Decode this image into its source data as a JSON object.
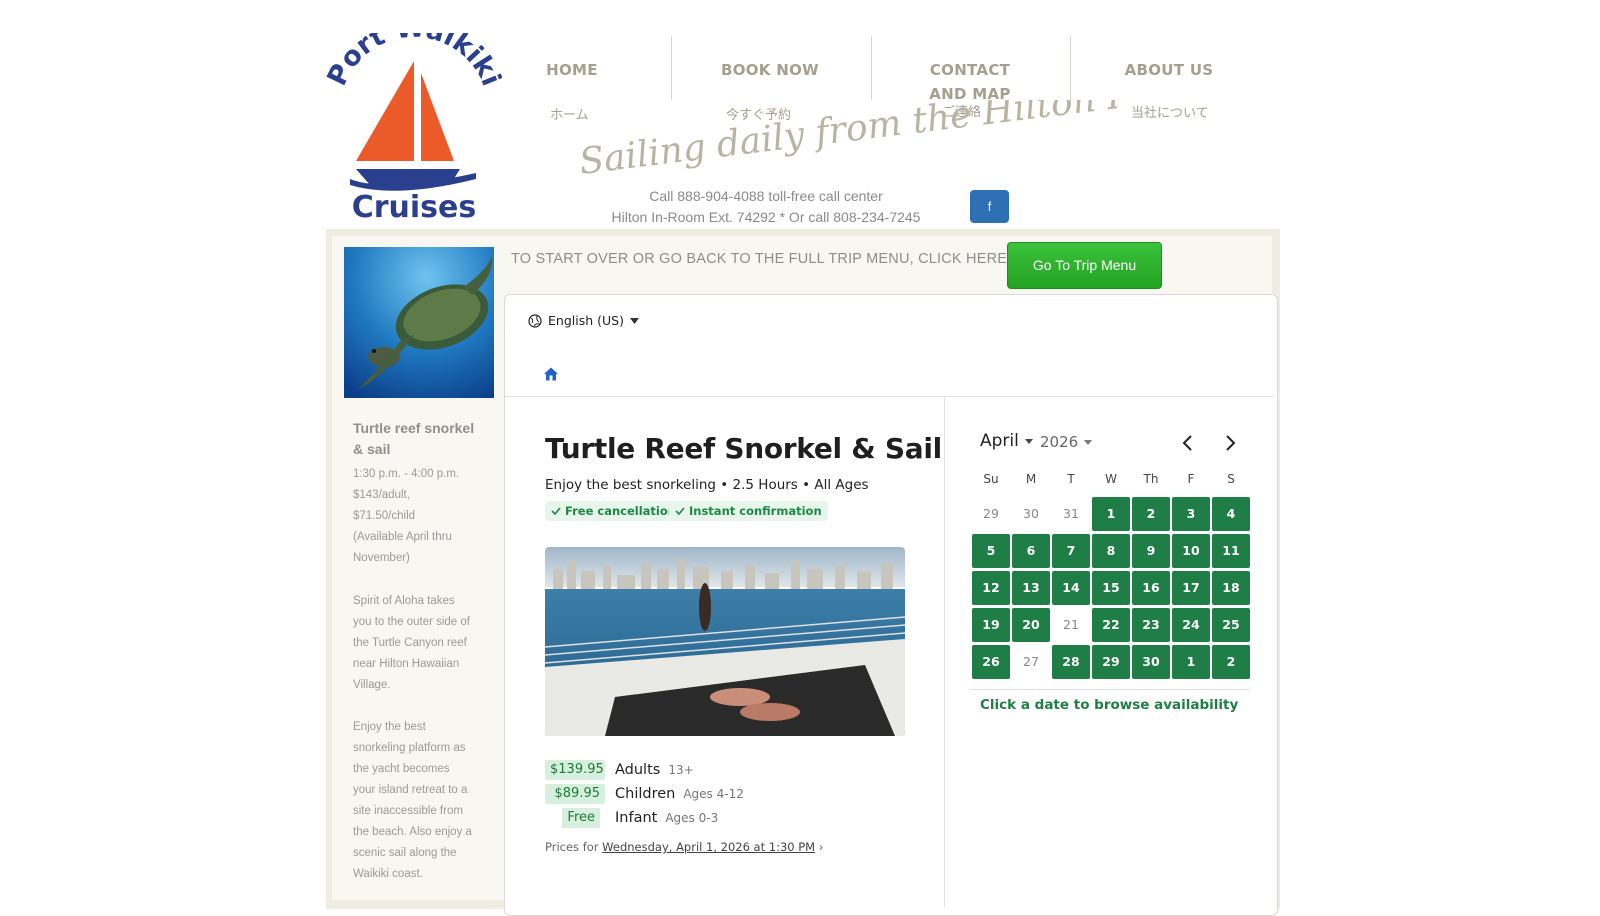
{
  "header": {
    "logo": {
      "line1": "Port Waikiki",
      "line2": "Cruises"
    },
    "nav": [
      {
        "en": "HOME",
        "jp": "ホーム"
      },
      {
        "en": "BOOK NOW",
        "jp": "今すぐ予約"
      },
      {
        "en": "CONTACT AND MAP",
        "jp": "ご連絡"
      },
      {
        "en": "ABOUT US",
        "jp": "当社について"
      }
    ],
    "tagline": "Sailing daily from the Hilton Pier",
    "phone1": "Call 888-904-4088 toll-free call center",
    "phone2": "Hilton In-Room Ext. 74292 * Or call 808-234-7245",
    "facebook_label": "f"
  },
  "trip_menu": {
    "text": "TO START OVER OR GO BACK TO THE FULL TRIP MENU, CLICK HERE:",
    "button": "Go To Trip Menu"
  },
  "sidebar": {
    "title": "Turtle reef snorkel & sail",
    "details": [
      "1:30 p.m. - 4:00 p.m.",
      "$143/adult,",
      "$71.50/child",
      "(Available April thru",
      "November)"
    ],
    "para1": [
      "Spirit of Aloha takes",
      "you to the outer side of",
      "the Turtle Canyon reef",
      "near Hilton Hawaiian",
      "Village."
    ],
    "para2": [
      "Enjoy the best",
      "snorkeling platform as",
      "the yacht becomes",
      "your island retreat to a",
      "site inaccessible from",
      "the beach. Also enjoy a",
      "scenic sail along the",
      "Waikiki coast."
    ]
  },
  "widget": {
    "language": "English (US)",
    "product_title": "Turtle Reef Snorkel & Sail",
    "product_subtitle": "Enjoy the best snorkeling • 2.5 Hours • All Ages",
    "badges": [
      "Free cancellation",
      "Instant confirmation"
    ],
    "prices": [
      {
        "price": "$139.95",
        "name": "Adults",
        "age": "13+"
      },
      {
        "price": "$89.95",
        "name": "Children",
        "age": "Ages 4-12"
      },
      {
        "price": "Free",
        "name": "Infant",
        "age": "Ages 0-3"
      }
    ],
    "prices_for_label": "Prices for",
    "prices_for_date": "Wednesday, April 1, 2026 at 1:30 PM",
    "prices_for_arrow": "›"
  },
  "calendar": {
    "month": "April",
    "year": "2026",
    "weekdays": [
      "Su",
      "M",
      "T",
      "W",
      "Th",
      "F",
      "S"
    ],
    "weeks": [
      [
        {
          "d": "29",
          "a": false
        },
        {
          "d": "30",
          "a": false
        },
        {
          "d": "31",
          "a": false
        },
        {
          "d": "1",
          "a": true
        },
        {
          "d": "2",
          "a": true
        },
        {
          "d": "3",
          "a": true
        },
        {
          "d": "4",
          "a": true
        }
      ],
      [
        {
          "d": "5",
          "a": true
        },
        {
          "d": "6",
          "a": true
        },
        {
          "d": "7",
          "a": true
        },
        {
          "d": "8",
          "a": true
        },
        {
          "d": "9",
          "a": true
        },
        {
          "d": "10",
          "a": true
        },
        {
          "d": "11",
          "a": true
        }
      ],
      [
        {
          "d": "12",
          "a": true
        },
        {
          "d": "13",
          "a": true
        },
        {
          "d": "14",
          "a": true
        },
        {
          "d": "15",
          "a": true
        },
        {
          "d": "16",
          "a": true
        },
        {
          "d": "17",
          "a": true
        },
        {
          "d": "18",
          "a": true
        }
      ],
      [
        {
          "d": "19",
          "a": true
        },
        {
          "d": "20",
          "a": true
        },
        {
          "d": "21",
          "a": false
        },
        {
          "d": "22",
          "a": true
        },
        {
          "d": "23",
          "a": true
        },
        {
          "d": "24",
          "a": true
        },
        {
          "d": "25",
          "a": true
        }
      ],
      [
        {
          "d": "26",
          "a": true
        },
        {
          "d": "27",
          "a": false
        },
        {
          "d": "28",
          "a": true
        },
        {
          "d": "29",
          "a": true
        },
        {
          "d": "30",
          "a": true
        },
        {
          "d": "1",
          "a": true
        },
        {
          "d": "2",
          "a": true
        }
      ]
    ],
    "hint": "Click a date to browse availability"
  },
  "colors": {
    "accent_green": "#1e7e46",
    "button_green": "#2bb12b",
    "logo_blue": "#2b3f8f",
    "sail_orange": "#ec5a2a"
  }
}
